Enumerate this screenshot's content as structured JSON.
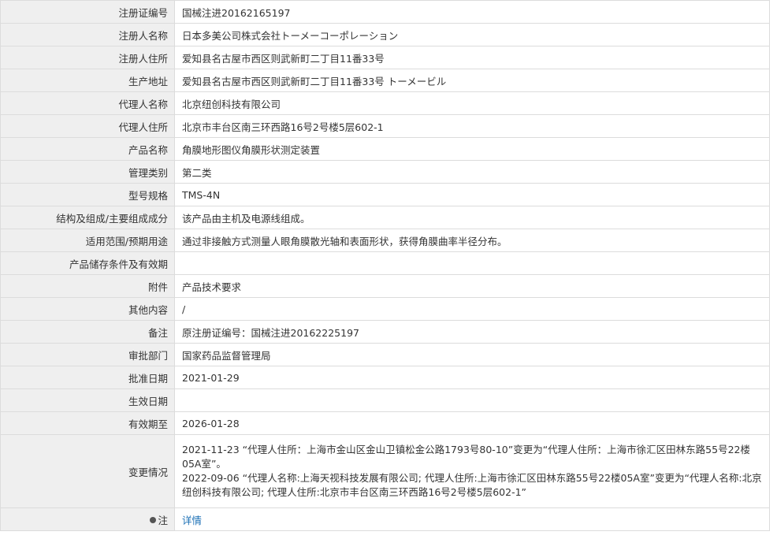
{
  "rows": [
    {
      "label": "注册证编号",
      "value": "国械注进20162165197"
    },
    {
      "label": "注册人名称",
      "value": "日本多美公司株式会社トーメーコーポレーション"
    },
    {
      "label": "注册人住所",
      "value": "爱知县名古屋市西区则武新町二丁目11番33号"
    },
    {
      "label": "生产地址",
      "value": "爱知县名古屋市西区则武新町二丁目11番33号 トーメービル"
    },
    {
      "label": "代理人名称",
      "value": "北京纽创科技有限公司"
    },
    {
      "label": "代理人住所",
      "value": "北京市丰台区南三环西路16号2号楼5层602-1"
    },
    {
      "label": "产品名称",
      "value": "角膜地形图仪角膜形状测定装置"
    },
    {
      "label": "管理类别",
      "value": "第二类"
    },
    {
      "label": "型号规格",
      "value": "TMS-4N"
    },
    {
      "label": "结构及组成/主要组成成分",
      "value": "该产品由主机及电源线组成。"
    },
    {
      "label": "适用范围/预期用途",
      "value": "通过非接触方式测量人眼角膜散光轴和表面形状，获得角膜曲率半径分布。"
    },
    {
      "label": "产品储存条件及有效期",
      "value": ""
    },
    {
      "label": "附件",
      "value": "产品技术要求"
    },
    {
      "label": "其他内容",
      "value": "/"
    },
    {
      "label": "备注",
      "value": "原注册证编号：国械注进20162225197"
    },
    {
      "label": "审批部门",
      "value": "国家药品监督管理局"
    },
    {
      "label": "批准日期",
      "value": "2021-01-29"
    },
    {
      "label": "生效日期",
      "value": ""
    },
    {
      "label": "有效期至",
      "value": "2026-01-28"
    }
  ],
  "changes": {
    "label": "变更情况",
    "entries": [
      "2021-11-23 “代理人住所：上海市金山区金山卫镇松金公路1793号80-10”变更为“代理人住所：上海市徐汇区田林东路55号22楼05A室”。",
      "2022-09-06 “代理人名称:上海天视科技发展有限公司; 代理人住所:上海市徐汇区田林东路55号22楼05A室”变更为“代理人名称:北京纽创科技有限公司; 代理人住所:北京市丰台区南三环西路16号2号楼5层602-1”"
    ]
  },
  "note": {
    "label": "注",
    "link": "详情"
  }
}
